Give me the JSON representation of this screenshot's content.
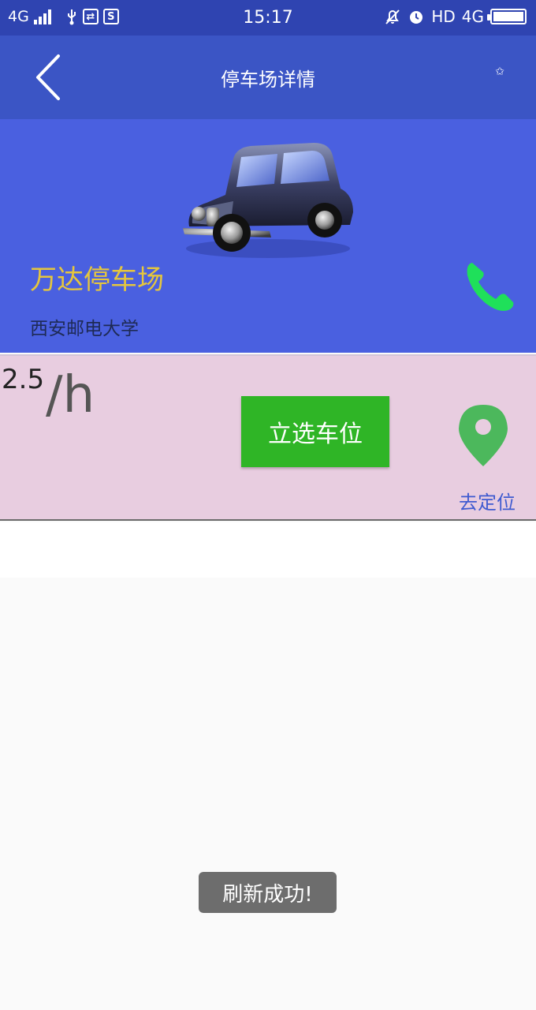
{
  "status_bar": {
    "network_left": "4G",
    "usb_icon": "usb-icon",
    "sb_box1": "⇄",
    "sb_box2": "S",
    "time": "15:17",
    "hd": "HD",
    "network_right": "4G"
  },
  "nav": {
    "title": "停车场详情",
    "star": "✩"
  },
  "parking": {
    "name": "万达停车场",
    "address": "西安邮电大学",
    "price": "2.5",
    "unit": "/h",
    "select_button": "立选车位",
    "locate_label": "去定位"
  },
  "toast": {
    "text": "刷新成功!"
  },
  "colors": {
    "status_bar": "#2f44b1",
    "nav_bar": "#3b55c5",
    "hero_bg": "#4a60e0",
    "name_text": "#e5c63d",
    "info_bg": "#e8cde0",
    "select_button": "#2fb526",
    "phone_icon": "#1fe05a",
    "pin_icon": "#4cb85c",
    "locate_text": "#3f5bd0"
  }
}
